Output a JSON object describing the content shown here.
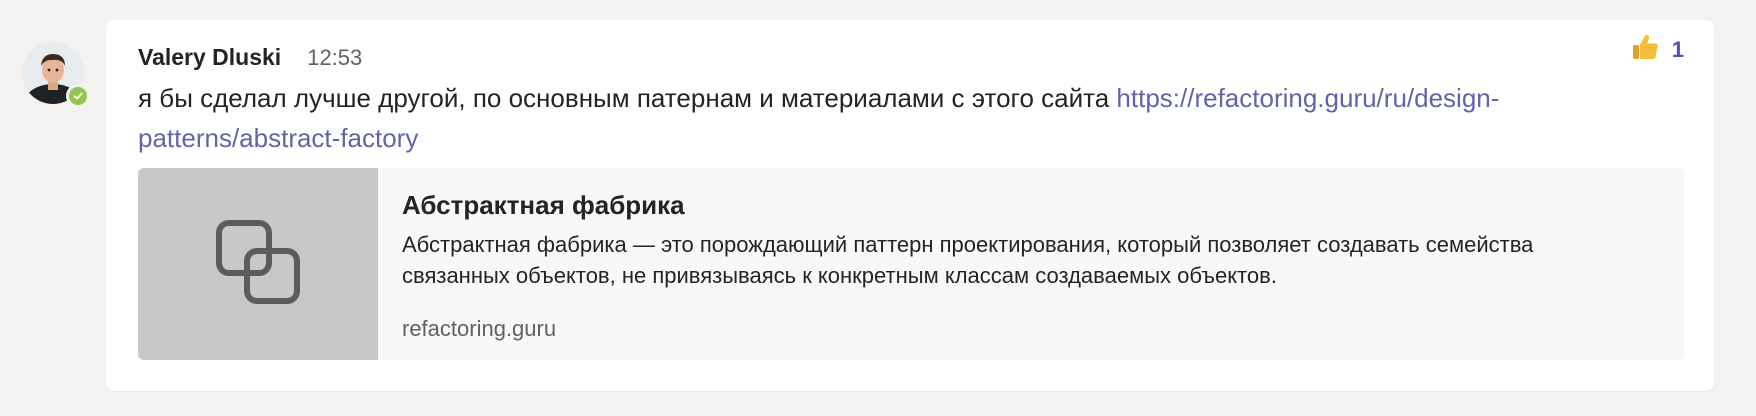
{
  "message": {
    "author": "Valery Dluski",
    "time": "12:53",
    "text": "я бы сделал лучше другой, по основным патернам и материалами с этого сайта ",
    "link": "https://refactoring.guru/ru/design-patterns/abstract-factory",
    "reaction": {
      "icon": "thumbs-up-icon",
      "count": "1"
    },
    "presence_status": "available",
    "presence_color": "#92c353"
  },
  "link_preview": {
    "title": "Абстрактная фабрика",
    "description": "Абстрактная фабрика — это порождающий паттерн проектирования, который позволяет создавать семейства связанных объектов, не привязываясь к конкретным классам создаваемых объектов.",
    "domain": "refactoring.guru",
    "thumbnail_icon": "link-icon"
  },
  "colors": {
    "link": "#6264a7",
    "reaction_count": "#4f52b2",
    "background": "#f3f2f1"
  }
}
